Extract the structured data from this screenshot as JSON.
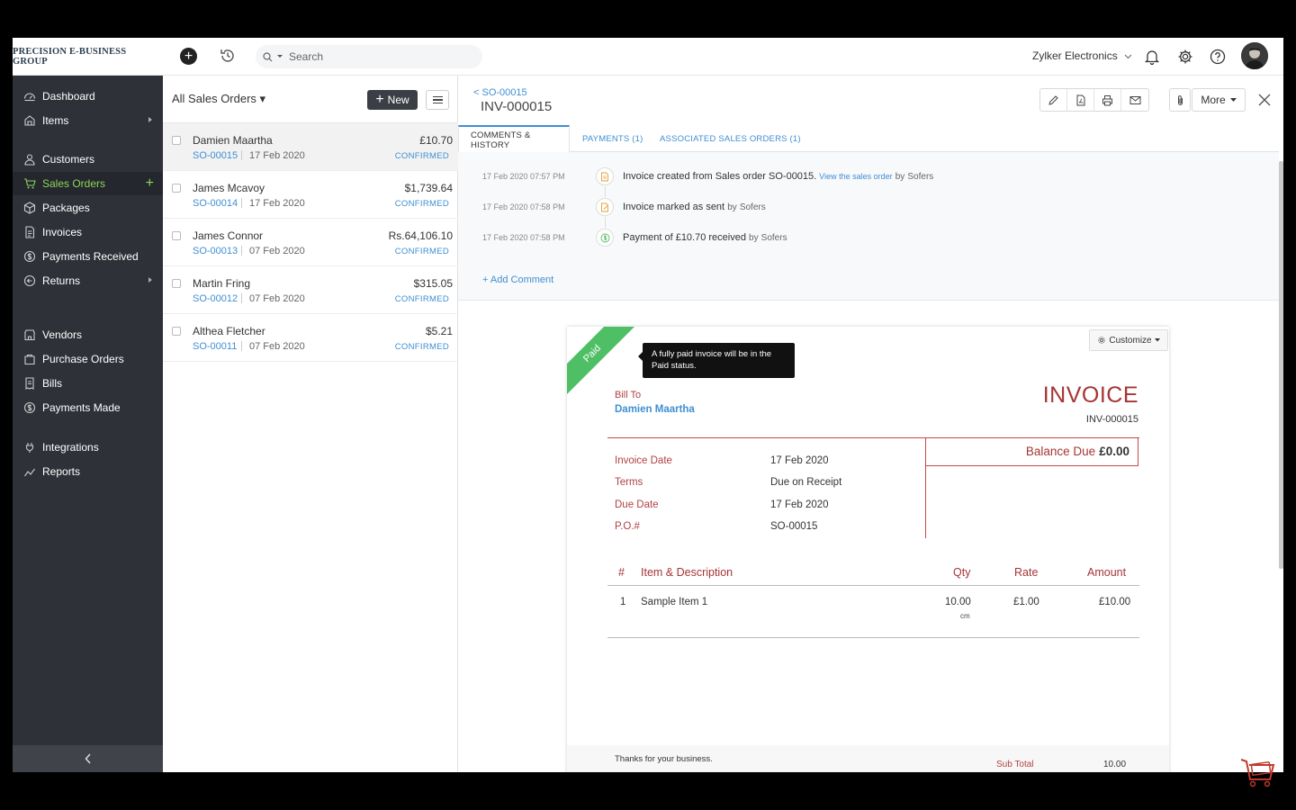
{
  "brand": "PRECISION E-BUSINESS GROUP",
  "search": {
    "placeholder": "Search"
  },
  "org_name": "Zylker Electronics",
  "sidebar": {
    "items": [
      {
        "label": "Dashboard",
        "icon": "dashboard-icon"
      },
      {
        "label": "Items",
        "icon": "items-icon"
      },
      {
        "label": "Customers",
        "icon": "customers-icon"
      },
      {
        "label": "Sales Orders",
        "icon": "sales-orders-icon"
      },
      {
        "label": "Packages",
        "icon": "packages-icon"
      },
      {
        "label": "Invoices",
        "icon": "invoices-icon"
      },
      {
        "label": "Payments Received",
        "icon": "payments-received-icon"
      },
      {
        "label": "Returns",
        "icon": "returns-icon"
      },
      {
        "label": "Vendors",
        "icon": "vendors-icon"
      },
      {
        "label": "Purchase Orders",
        "icon": "purchase-orders-icon"
      },
      {
        "label": "Bills",
        "icon": "bills-icon"
      },
      {
        "label": "Payments Made",
        "icon": "payments-made-icon"
      },
      {
        "label": "Integrations",
        "icon": "integrations-icon"
      },
      {
        "label": "Reports",
        "icon": "reports-icon"
      }
    ],
    "active_color": "#8dd55a"
  },
  "list": {
    "title": "All Sales Orders ▾",
    "new_label": "New",
    "rows": [
      {
        "customer": "Damien Maartha",
        "so": "SO-00015",
        "date": "17 Feb 2020",
        "amount": "£10.70",
        "status": "CONFIRMED"
      },
      {
        "customer": "James Mcavoy",
        "so": "SO-00014",
        "date": "17 Feb 2020",
        "amount": "$1,739.64",
        "status": "CONFIRMED"
      },
      {
        "customer": "James Connor",
        "so": "SO-00013",
        "date": "07 Feb 2020",
        "amount": "Rs.64,106.10",
        "status": "CONFIRMED"
      },
      {
        "customer": "Martin Fring",
        "so": "SO-00012",
        "date": "07 Feb 2020",
        "amount": "$315.05",
        "status": "CONFIRMED"
      },
      {
        "customer": "Althea Fletcher",
        "so": "SO-00011",
        "date": "07 Feb 2020",
        "amount": "$5.21",
        "status": "CONFIRMED"
      }
    ]
  },
  "detail": {
    "back_link": "< SO-00015",
    "title": "INV-000015",
    "more_label": "More",
    "tabs": [
      "COMMENTS & HISTORY",
      "PAYMENTS (1)",
      "ASSOCIATED SALES ORDERS (1)"
    ],
    "history": [
      {
        "time": "17 Feb 2020 07:57 PM",
        "text": "Invoice created from Sales order SO-00015.",
        "link": "View the sales order",
        "by": "by",
        "user": "Sofers"
      },
      {
        "time": "17 Feb 2020 07:58 PM",
        "text": "Invoice marked as sent",
        "by": "by",
        "user": "Sofers"
      },
      {
        "time": "17 Feb 2020 07:58 PM",
        "text": "Payment of £10.70 received",
        "by": "by",
        "user": "Sofers"
      }
    ],
    "add_comment": "+ Add Comment"
  },
  "invoice": {
    "ribbon": "Paid",
    "tooltip": "A fully paid invoice will be in the Paid status.",
    "customize_label": "Customize",
    "bill_to_label": "Bill To",
    "bill_to_name": "Damien Maartha",
    "heading": "INVOICE",
    "number": "INV-000015",
    "balance_label": "Balance Due",
    "balance_value": "£0.00",
    "meta": [
      {
        "label": "Invoice Date",
        "value": "17 Feb 2020"
      },
      {
        "label": "Terms",
        "value": "Due on Receipt"
      },
      {
        "label": "Due Date",
        "value": "17 Feb 2020"
      },
      {
        "label": "P.O.#",
        "value": "SO-00015"
      }
    ],
    "columns": [
      "#",
      "Item & Description",
      "Qty",
      "Rate",
      "Amount"
    ],
    "items": [
      {
        "num": "1",
        "desc": "Sample Item 1",
        "qty": "10.00",
        "unit": "cm",
        "rate": "£1.00",
        "amount": "£10.00"
      }
    ],
    "thanks": "Thanks for your business.",
    "subtotal_label": "Sub Total",
    "subtotal_value": "10.00",
    "accent_color": "#a63434"
  }
}
